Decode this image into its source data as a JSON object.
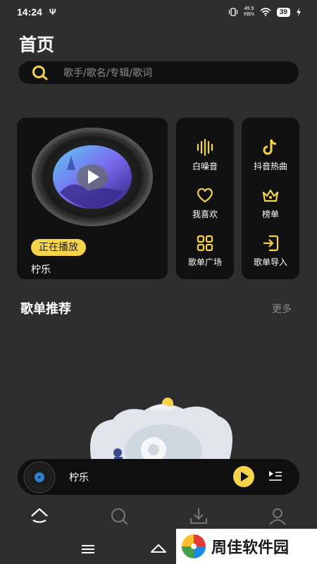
{
  "status": {
    "time": "14:24",
    "net_speed_value": "49.9",
    "net_speed_unit": "KB/s",
    "battery": "39"
  },
  "header": {
    "title": "首页"
  },
  "search": {
    "placeholder": "歌手/歌名/专辑/歌词"
  },
  "now_playing": {
    "badge": "正在播放",
    "song": "柠乐"
  },
  "quick_links": [
    {
      "label": "白噪音",
      "icon": "waveform-icon"
    },
    {
      "label": "抖音热曲",
      "icon": "tiktok-icon"
    },
    {
      "label": "我喜欢",
      "icon": "heart-icon"
    },
    {
      "label": "榜单",
      "icon": "crown-icon"
    },
    {
      "label": "歌单广场",
      "icon": "grid-icon"
    },
    {
      "label": "歌单导入",
      "icon": "import-icon"
    }
  ],
  "playlist_section": {
    "title": "歌单推荐",
    "more": "更多"
  },
  "mini_player": {
    "song": "柠乐"
  },
  "bottom_nav": [
    "home-icon",
    "search-icon",
    "download-icon",
    "profile-icon"
  ],
  "system_nav": [
    "menu-icon",
    "home-icon"
  ],
  "watermark": {
    "text": "周佳软件园"
  },
  "colors": {
    "accent": "#f5d34a",
    "background": "#2e2e2e",
    "card": "#111111"
  }
}
